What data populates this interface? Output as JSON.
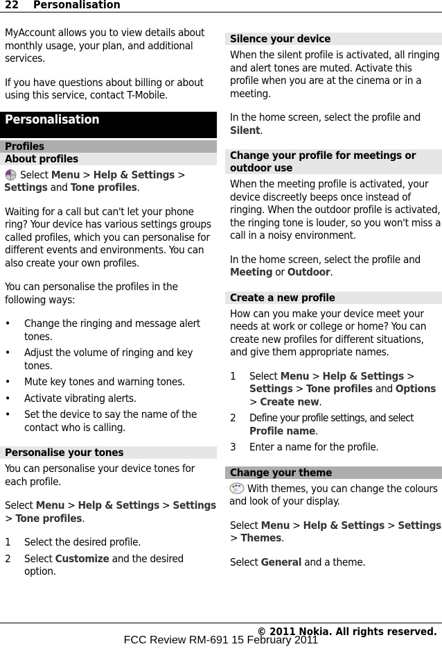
{
  "header": {
    "page_number": "22",
    "chapter": "Personalisation"
  },
  "left": {
    "intro": [
      "MyAccount allows you to view details about monthly usage, your plan, and additional services.",
      "If you have questions about billing or about using this service, contact T-Mobile."
    ],
    "section_title": "Personalisation",
    "subsection_title": "Profiles",
    "about_profiles": {
      "title": "About profiles",
      "icon": "settings-app-icon",
      "path": {
        "pre": "Select",
        "menu": "Menu",
        "sep1": " > ",
        "help": "Help & Settings",
        "sep2": " >",
        "settings": "Settings",
        "and": " and ",
        "tone": "Tone profiles",
        "end": "."
      },
      "body1": "Waiting for a call but can't let your phone ring? Your device has various settings groups called profiles, which you can personalise for different events and environments. You can also create your own profiles.",
      "body2": "You can personalise the profiles in the following ways:",
      "bullets": [
        "Change the ringing and message alert tones.",
        "Adjust the volume of ringing and key tones.",
        "Mute key tones and warning tones.",
        "Activate vibrating alerts.",
        "Set the device to say the name of the contact who is calling."
      ],
      "bullet_char": "•"
    },
    "tones": {
      "title": "Personalise your tones",
      "body": "You can personalise your device tones for each profile.",
      "path": {
        "pre": "Select ",
        "menu": "Menu",
        "sep1": "  > ",
        "help": "Help & Settings",
        "sep2": "  >",
        "settings": "Settings",
        "sep3": "  > ",
        "tone": "Tone profiles",
        "end": "."
      },
      "steps": [
        {
          "num": "1",
          "pre": "Select the desired profile.",
          "bold": "",
          "post": ""
        },
        {
          "num": "2",
          "pre": "Select ",
          "bold": "Customize",
          "post": " and the desired option."
        }
      ]
    }
  },
  "right": {
    "silence": {
      "title": "Silence your device",
      "body": "When the silent profile is activated, all ringing and alert tones are muted. Activate this profile when you are at the cinema or in a meeting.",
      "instr_pre": "In the home screen, select the profile and ",
      "instr_bold": "Silent",
      "instr_post": "."
    },
    "meeting": {
      "title": "Change your profile for meetings or outdoor use",
      "body": "When the meeting profile is activated, your device discreetly beeps once instead of ringing. When the outdoor profile is activated, the ringing tone is louder, so you won't miss a call in a noisy environment.",
      "instr_pre": "In the home screen, select the profile and ",
      "bold1": "Meeting",
      "or": " or ",
      "bold2": "Outdoor",
      "end": "."
    },
    "create": {
      "title": "Create a new profile",
      "body": "How can you make your device meet your needs at work or college or home? You can create new profiles for different situations, and give them appropriate names.",
      "step1": {
        "num": "1",
        "pre": "Select ",
        "menu": "Menu",
        "sep1": "  > ",
        "help": "Help & Settings",
        "sep2": "  >",
        "settings": "Settings",
        "sep3": "  > ",
        "tone": "Tone profiles",
        "and": " and ",
        "options": "Options",
        "sep4": "  > ",
        "create": "Create new",
        "end": "."
      },
      "step2": {
        "num": "2",
        "pre": "Define your profile settings, and select ",
        "bold": "Profile name",
        "end": "."
      },
      "step3": {
        "num": "3",
        "text": "Enter a name for the profile."
      }
    },
    "theme": {
      "title": "Change your theme",
      "icon": "themes-palette-icon",
      "body": " With themes, you can change the colours and look of your display.",
      "path": {
        "pre": "Select ",
        "menu": "Menu",
        "sep1": "  > ",
        "help": "Help & Settings",
        "sep2": "  >",
        "settings": "Settings",
        "sep3": "  > ",
        "themes": "Themes",
        "end": "."
      },
      "general_pre": "Select ",
      "general_bold": "General",
      "general_post": " and a theme."
    }
  },
  "footer": {
    "copyright": "© 2011 Nokia. All rights reserved.",
    "fcc": "FCC Review  RM-691  15 February 2011"
  }
}
